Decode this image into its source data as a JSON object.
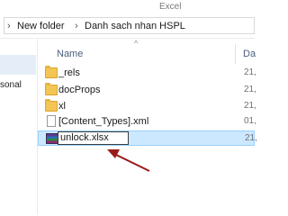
{
  "window": {
    "title": "Excel"
  },
  "breadcrumb": {
    "segments": [
      "New folder",
      "Danh sach nhan HSPL"
    ]
  },
  "nav": {
    "visible_text": "sonal"
  },
  "columns": {
    "name": "Name",
    "date": "Da"
  },
  "files": [
    {
      "name": "_rels",
      "type": "folder",
      "date": "21,"
    },
    {
      "name": "docProps",
      "type": "folder",
      "date": "21,"
    },
    {
      "name": "xl",
      "type": "folder",
      "date": "21,"
    },
    {
      "name": "[Content_Types].xml",
      "type": "document",
      "date": "01,"
    },
    {
      "name": "unlock.xlsx",
      "type": "archive",
      "date": "21,"
    }
  ],
  "annotation": {
    "color": "#9b1b1b"
  }
}
